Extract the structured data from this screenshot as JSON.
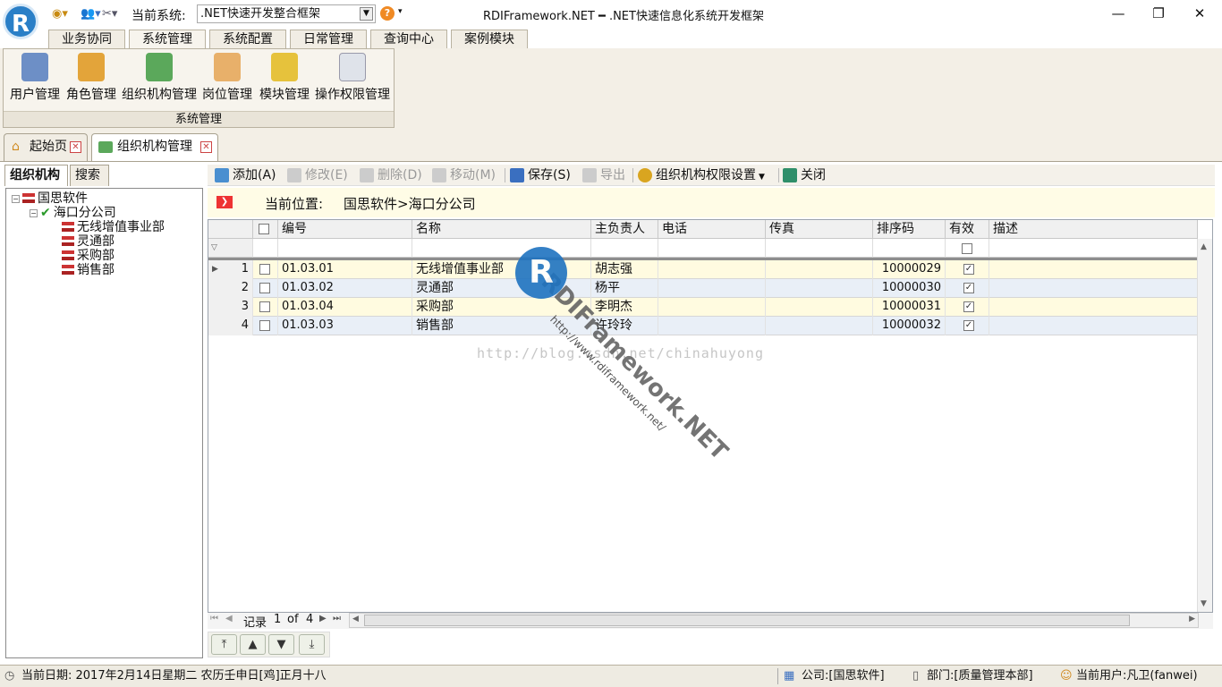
{
  "titlebar": {
    "current_system_label": "当前系统:",
    "current_system_value": ".NET快速开发整合框架",
    "window_title": "RDIFramework.NET ━ .NET快速信息化系统开发框架",
    "logo_letter": "R",
    "minimize": "—",
    "restore": "❐",
    "close": "✕"
  },
  "ribbon_tabs": [
    "业务协同",
    "系统管理",
    "系统配置",
    "日常管理",
    "查询中心",
    "案例模块"
  ],
  "ribbon": {
    "group_label": "系统管理",
    "buttons": [
      "用户管理",
      "角色管理",
      "组织机构管理",
      "岗位管理",
      "模块管理",
      "操作权限管理"
    ]
  },
  "doc_tabs": [
    "起始页",
    "组织机构管理"
  ],
  "left_panel": {
    "tabs": [
      "组织机构",
      "搜索"
    ],
    "tree": {
      "root": "国思软件",
      "company": "海口分公司",
      "departments": [
        "无线增值事业部",
        "灵通部",
        "采购部",
        "销售部"
      ]
    }
  },
  "toolbar": {
    "add": "添加(A)",
    "edit": "修改(E)",
    "delete": "删除(D)",
    "move": "移动(M)",
    "save": "保存(S)",
    "export": "导出",
    "permission": "组织机构权限设置",
    "close": "关闭"
  },
  "location": {
    "label": "当前位置:",
    "value": "国思软件>海口分公司"
  },
  "grid": {
    "columns": [
      "编号",
      "名称",
      "主负责人",
      "电话",
      "传真",
      "排序码",
      "有效",
      "描述"
    ],
    "rows": [
      {
        "n": "1",
        "code": "01.03.01",
        "name": "无线增值事业部",
        "owner": "胡志强",
        "phone": "",
        "fax": "",
        "sort": "10000029",
        "valid": true,
        "desc": ""
      },
      {
        "n": "2",
        "code": "01.03.02",
        "name": "灵通部",
        "owner": "杨平",
        "phone": "",
        "fax": "",
        "sort": "10000030",
        "valid": true,
        "desc": ""
      },
      {
        "n": "3",
        "code": "01.03.04",
        "name": "采购部",
        "owner": "李明杰",
        "phone": "",
        "fax": "",
        "sort": "10000031",
        "valid": true,
        "desc": ""
      },
      {
        "n": "4",
        "code": "01.03.03",
        "name": "销售部",
        "owner": "许玲玲",
        "phone": "",
        "fax": "",
        "sort": "10000032",
        "valid": true,
        "desc": ""
      }
    ]
  },
  "pager": {
    "record_label": "记录",
    "current": "1",
    "of": "of",
    "total": "4"
  },
  "watermark": {
    "brand": "RDIFramework.NET",
    "url": "http://www.rdiframework.net/",
    "blog": "http://blog.csdn.net/chinahuyong"
  },
  "statusbar": {
    "date": "当前日期: 2017年2月14日星期二 农历壬申日[鸡]正月十八",
    "company": "公司:[国思软件]",
    "department": "部门:[质量管理本部]",
    "user": "当前用户:凡卫(fanwei)"
  },
  "colors": {
    "accent_blue": "#2a7fc7",
    "location_bg": "#fffce6",
    "row_odd": "#fffbe0",
    "row_even": "#e9eff7"
  }
}
